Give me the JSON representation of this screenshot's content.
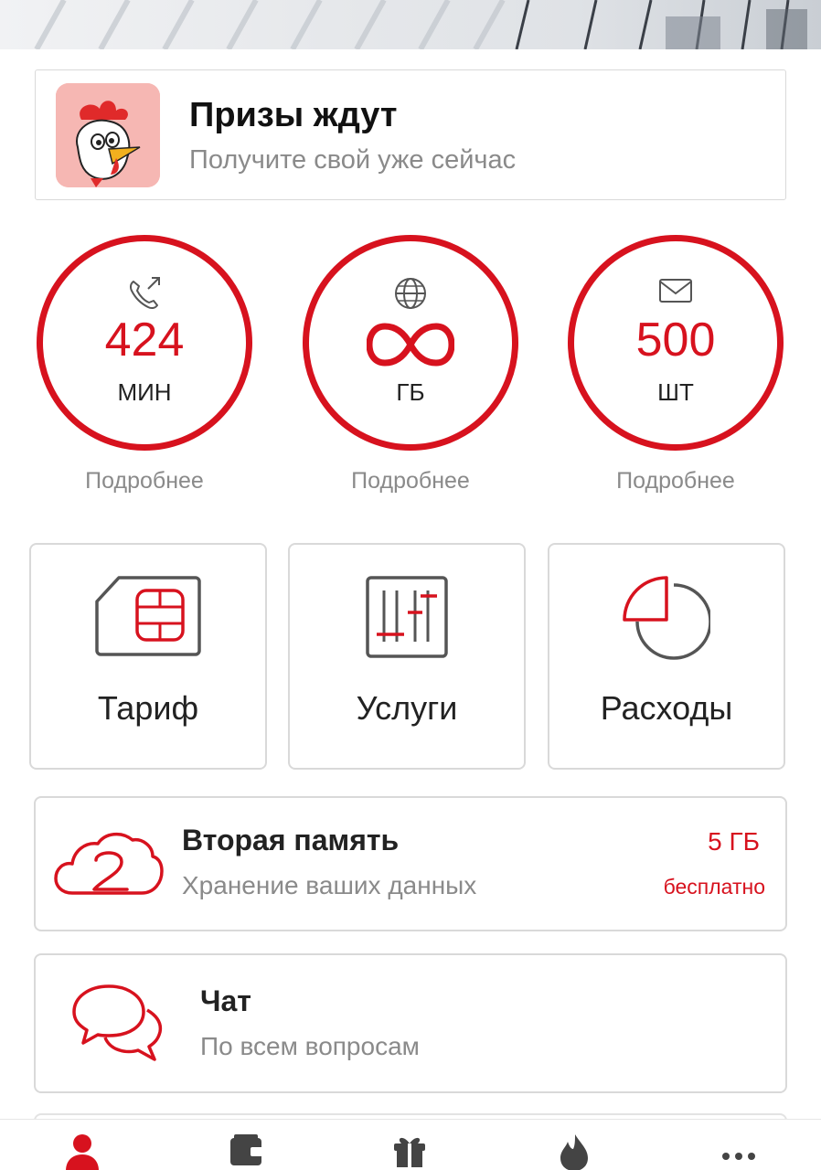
{
  "promo": {
    "title": "Призы ждут",
    "subtitle": "Получите свой уже сейчас",
    "image": "rooster-mascot"
  },
  "balances": [
    {
      "icon": "phone-call-icon",
      "value": "424",
      "unit": "МИН",
      "link": "Подробнее"
    },
    {
      "icon": "globe-icon",
      "value": "∞",
      "unit": "ГБ",
      "link": "Подробнее"
    },
    {
      "icon": "envelope-icon",
      "value": "500",
      "unit": "ШТ",
      "link": "Подробнее"
    }
  ],
  "tiles": [
    {
      "icon": "sim-card-icon",
      "label": "Тариф"
    },
    {
      "icon": "sliders-icon",
      "label": "Услуги"
    },
    {
      "icon": "pie-chart-icon",
      "label": "Расходы"
    }
  ],
  "storage": {
    "title": "Вторая память",
    "subtitle": "Хранение ваших данных",
    "amount": "5 ГБ",
    "amount_note": "бесплатно",
    "icon": "cloud-two-icon"
  },
  "chat": {
    "title": "Чат",
    "subtitle": "По всем вопросам",
    "icon": "chat-bubbles-icon"
  },
  "bottom_nav": [
    {
      "icon": "profile-icon",
      "active": true
    },
    {
      "icon": "wallet-icon",
      "active": false
    },
    {
      "icon": "gift-icon",
      "active": false
    },
    {
      "icon": "flame-icon",
      "active": false
    },
    {
      "icon": "more-icon",
      "active": false
    }
  ],
  "colors": {
    "accent": "#d7121e",
    "text": "#222222",
    "muted": "#8a8a8a",
    "border": "#d9d9d9",
    "icon_gray": "#555555"
  }
}
